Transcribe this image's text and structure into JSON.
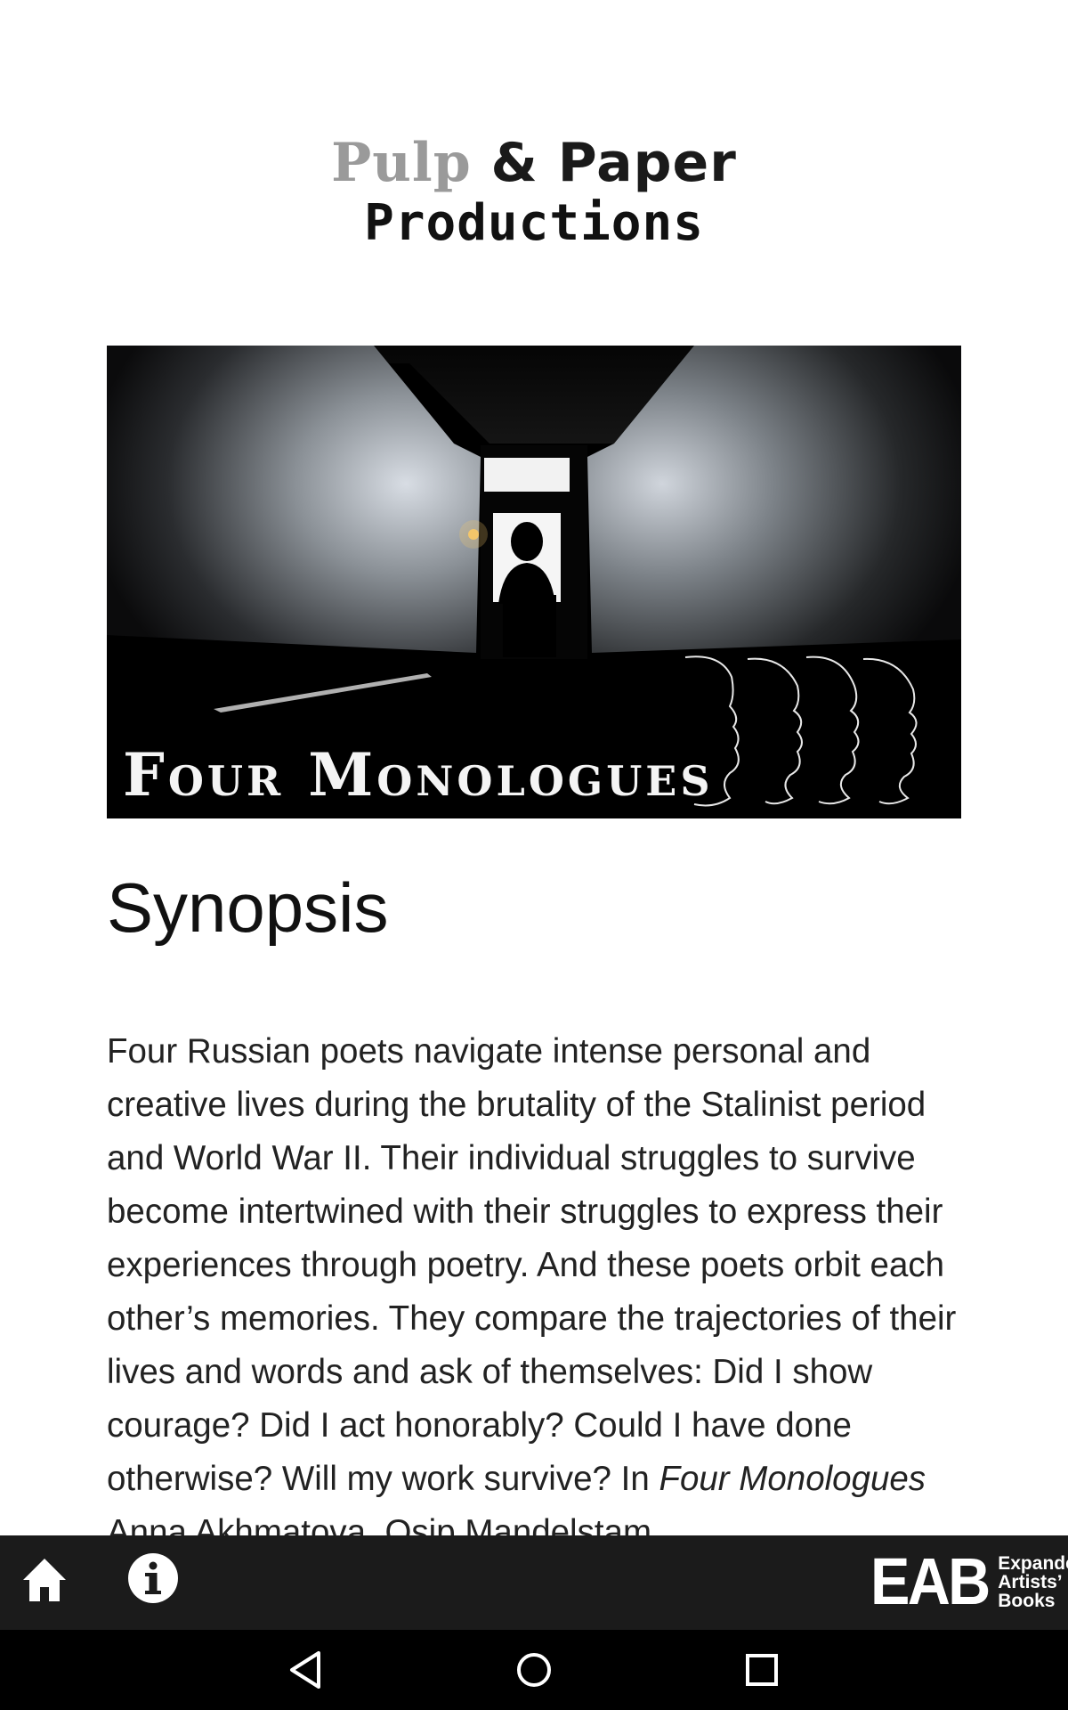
{
  "header": {
    "logo_word1": "Pulp",
    "logo_word2": "& Paper",
    "logo_word3": "Productions"
  },
  "poster": {
    "title": "Four Monologues"
  },
  "synopsis": {
    "heading": "Synopsis",
    "body_main": "Four Russian poets navigate intense personal and creative lives during the brutality of the Stalinist period and World War II. Their individual struggles to survive become intertwined with their struggles to express their experiences through poetry. And these poets orbit each other’s memories. They compare the trajectories of their lives and words and ask of themselves: Did I show courage? Did I act honorably? Could I have done otherwise? Will my work survive? In ",
    "body_italic": "Four Monologues",
    "body_tail": " Anna Akhmatova, Osip Mandelstam"
  },
  "app_bar": {
    "home_icon": "home-icon",
    "info_icon": "info-icon",
    "brand_big": "EAB",
    "brand_line1": "Expanded",
    "brand_line2": "Artists’",
    "brand_line3": "Books",
    "bar_color": "#1b1b1b"
  },
  "nav_bar": {
    "back_icon": "back-icon",
    "home_icon": "circle-home-icon",
    "recents_icon": "recents-icon"
  }
}
